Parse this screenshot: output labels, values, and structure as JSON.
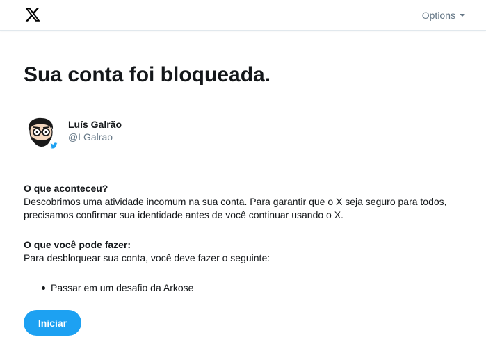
{
  "header": {
    "logo_icon": "x-logo-icon",
    "options_label": "Options"
  },
  "main": {
    "title": "Sua conta foi bloqueada."
  },
  "profile": {
    "name": "Luís Galrão",
    "handle": "@LGalrao",
    "avatar_icon": "cartoon-avatar-icon",
    "badge_icon": "twitter-bird-icon"
  },
  "what_happened": {
    "heading": "O que aconteceu?",
    "body": "Descobrimos uma atividade incomum na sua conta. Para garantir que o X seja seguro para todos, precisamos confirmar sua identidade antes de você continuar usando o X."
  },
  "what_to_do": {
    "heading": "O que você pode fazer:",
    "body": "Para desbloquear sua conta, você deve fazer o seguinte:",
    "steps": [
      "Passar em um desafio da Arkose"
    ]
  },
  "actions": {
    "start_label": "Iniciar"
  },
  "colors": {
    "accent": "#1da1f2",
    "text": "#14171a",
    "muted": "#657786"
  }
}
